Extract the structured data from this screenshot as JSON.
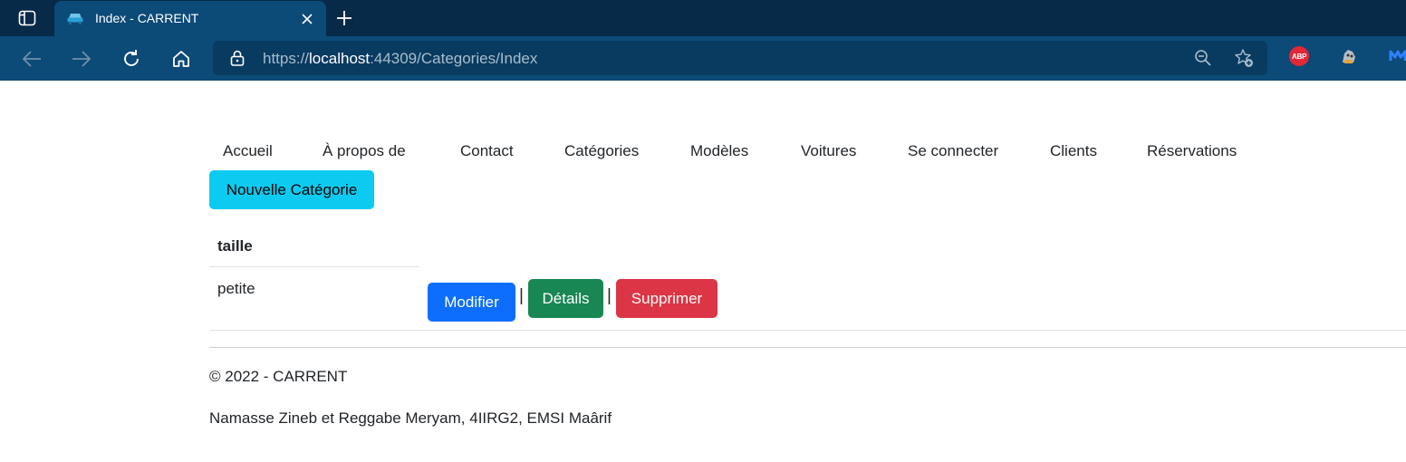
{
  "browser": {
    "tab_title": "Index - CARRENT",
    "url_prefix": "https://",
    "url_host": "localhost",
    "url_rest": ":44309/Categories/Index",
    "extensions": {
      "abp_label": "ABP"
    }
  },
  "nav": {
    "items": [
      {
        "label": "Accueil"
      },
      {
        "label": "À propos de"
      },
      {
        "label": "Contact"
      },
      {
        "label": "Catégories"
      },
      {
        "label": "Modèles"
      },
      {
        "label": "Voitures"
      },
      {
        "label": "Se connecter"
      },
      {
        "label": "Clients"
      },
      {
        "label": "Réservations"
      }
    ]
  },
  "main": {
    "new_button_label": "Nouvelle Catégorie",
    "table": {
      "header": "taille",
      "rows": [
        {
          "value": "petite",
          "edit_label": "Modifier",
          "details_label": "Détails",
          "delete_label": "Supprimer",
          "separator": "|"
        }
      ]
    }
  },
  "footer": {
    "copyright": "© 2022 - CARRENT",
    "authors": "Namasse Zineb et Reggabe Meryam, 4IIRG2, EMSI Maârif"
  },
  "colors": {
    "tabstrip": "#072a48",
    "toolbar": "#0c4a78",
    "btn_info": "#0dcaf0",
    "btn_primary": "#0d6efd",
    "btn_success": "#198754",
    "btn_danger": "#dc3545"
  },
  "icons": {
    "tab_actions": "tab-actions-icon",
    "favicon": "car-icon",
    "close": "close-icon",
    "new_tab": "plus-icon",
    "back": "back-arrow-icon",
    "forward": "forward-arrow-icon",
    "refresh": "refresh-icon",
    "home": "home-icon",
    "lock": "lock-icon",
    "zoom": "zoom-out-icon",
    "favorites": "add-favorite-icon"
  }
}
